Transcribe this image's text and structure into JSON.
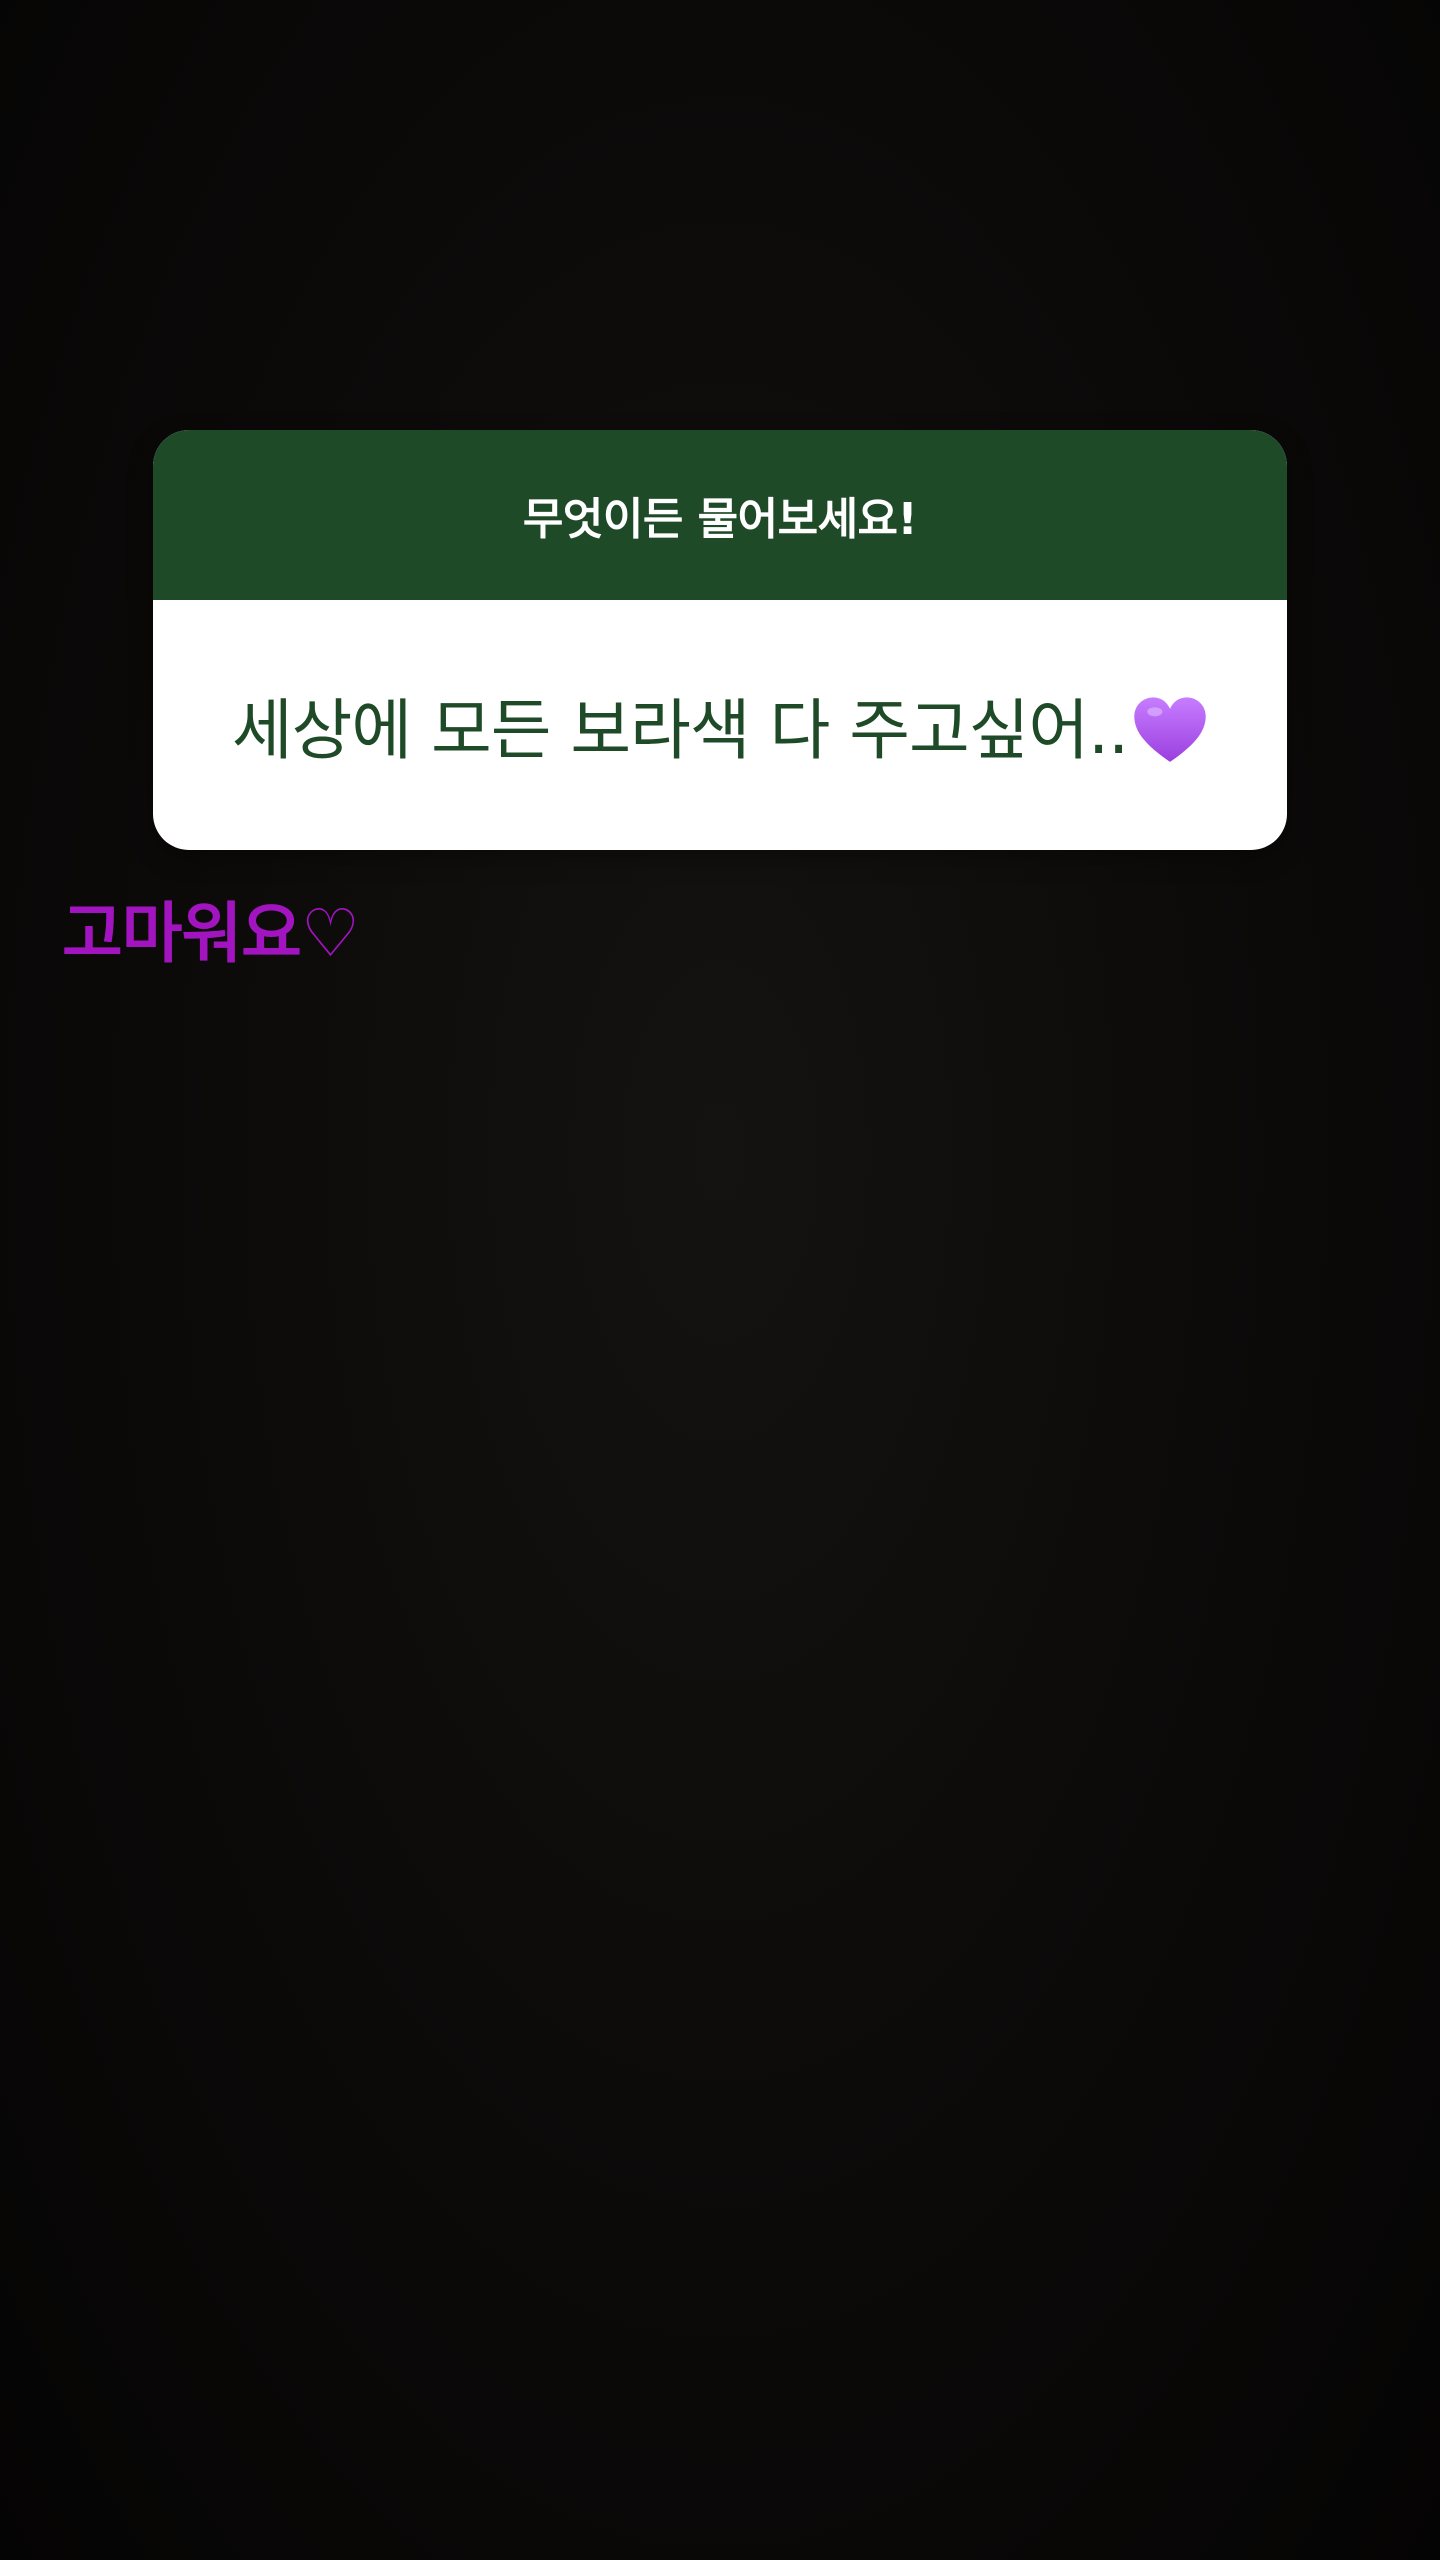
{
  "story": {
    "question_card": {
      "title": "무엇이든 물어보세요!",
      "answer": "세상에 모든 보라색 다 주고싶어..",
      "answer_emoji_icon": "purple-heart-icon",
      "header_color": "#1f4a27",
      "body_color": "#ffffff",
      "answer_color": "#1f4a27"
    },
    "reply": {
      "text": "고마워요♡",
      "color": "#a214c0"
    },
    "background_color": "#0b0908"
  }
}
